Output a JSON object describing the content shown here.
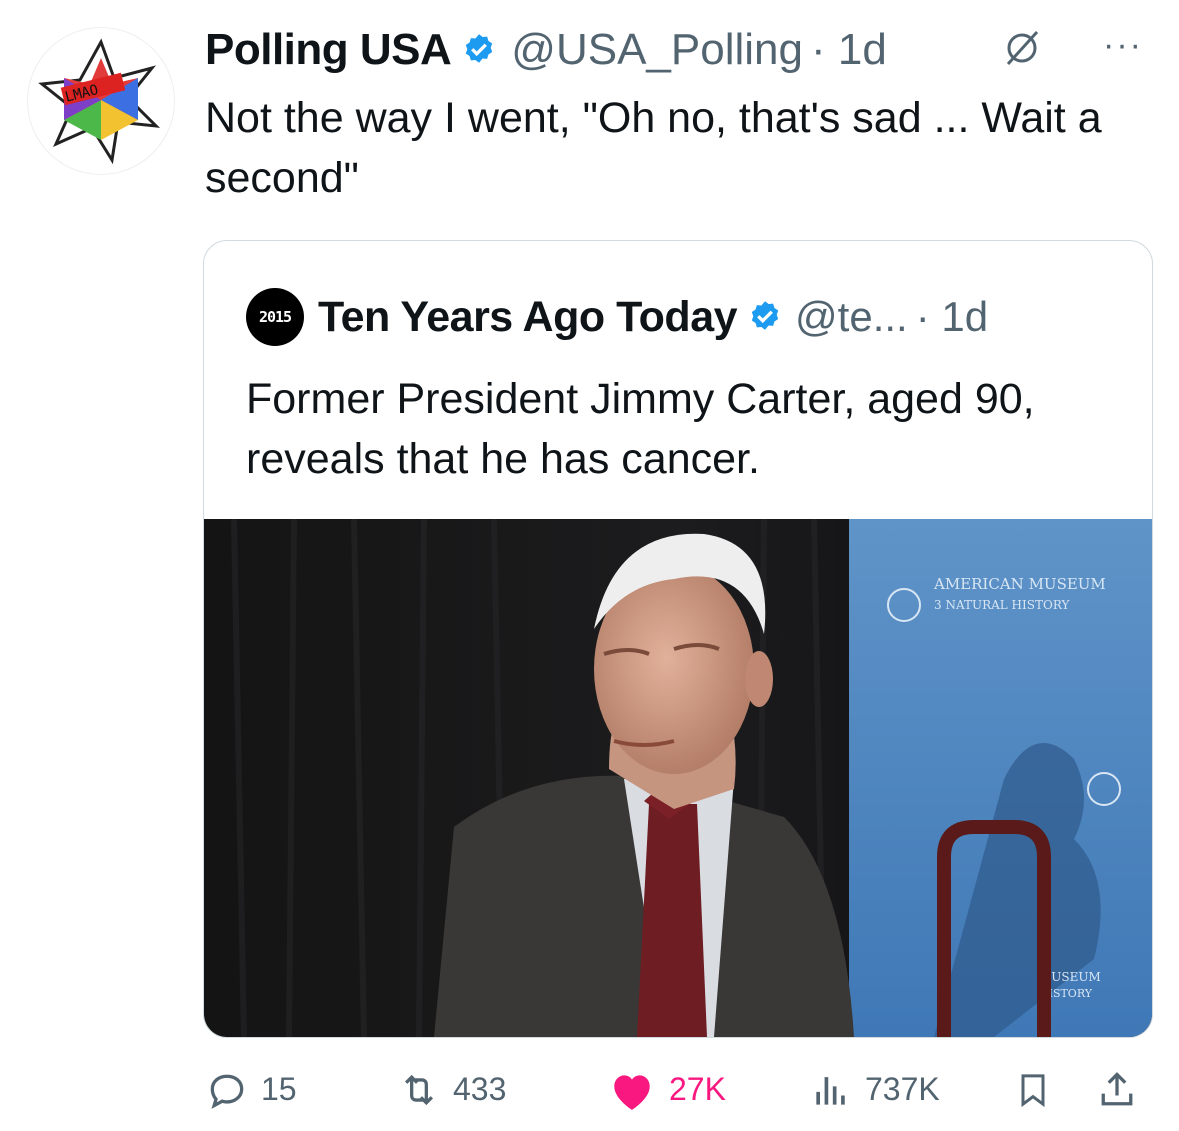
{
  "post": {
    "author_name": "Polling USA",
    "author_handle": "@USA_Polling",
    "time": "· 1d",
    "avatar_text": "LMAO",
    "text": "Not the way I went, \"Oh no, that's sad ... Wait a second\""
  },
  "quoted": {
    "avatar_text": "2015",
    "author_name": "Ten Years Ago Today",
    "author_handle": "@te...",
    "time": "· 1d",
    "text": "Former President Jimmy Carter, aged 90, reveals that he has cancer.",
    "image": {
      "banner_line1": "AMERICAN MUSEUM",
      "banner_line2": "3 NATURAL HISTORY",
      "banner_bottom1": "MUSEUM",
      "banner_bottom2": "HISTORY"
    }
  },
  "actions": {
    "replies": "15",
    "reposts": "433",
    "likes": "27K",
    "views": "737K"
  },
  "icons": [
    "verified-icon",
    "grok-icon",
    "more-icon",
    "reply-icon",
    "repost-icon",
    "like-icon",
    "views-icon",
    "bookmark-icon",
    "share-icon"
  ],
  "colors": {
    "verified": "#1d9bf0",
    "like": "#f91880",
    "secondary": "#536471"
  }
}
